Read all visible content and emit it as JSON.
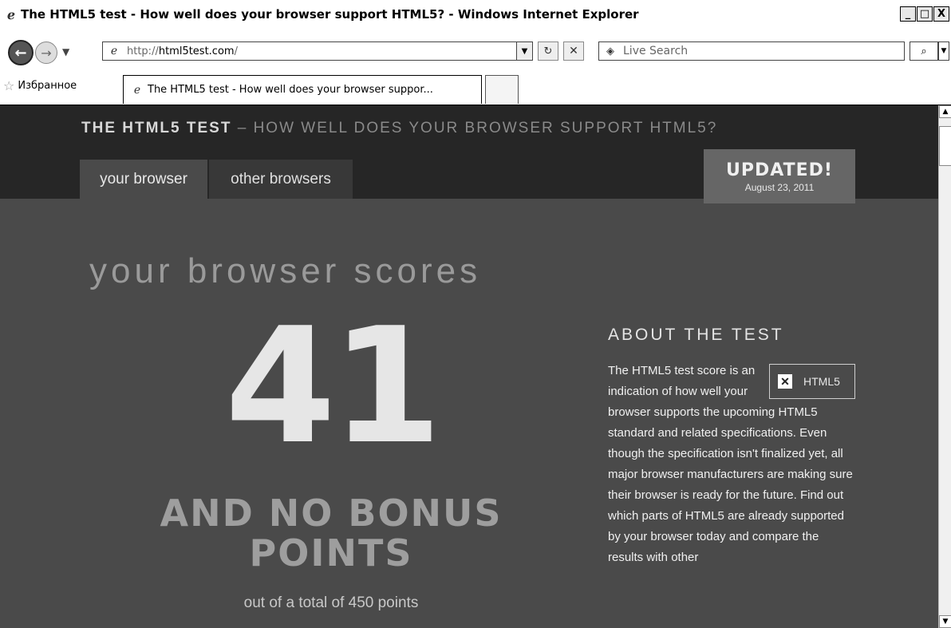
{
  "window": {
    "title": "The HTML5 test - How well does your browser support HTML5? - Windows Internet Explorer",
    "controls": [
      "_",
      "□",
      "X"
    ]
  },
  "toolbar": {
    "address_prefix": "http://",
    "address_domain": "html5test.com",
    "address_suffix": "/",
    "search_placeholder": "Live Search"
  },
  "favorites": {
    "label": "Избранное"
  },
  "tabs": [
    {
      "label": "The HTML5 test - How well does your browser suppor..."
    }
  ],
  "site": {
    "title_main": "THE HTML5 TEST",
    "title_sub": " – HOW WELL DOES YOUR BROWSER SUPPORT HTML5?",
    "nav": [
      "your browser",
      "other browsers"
    ],
    "updated_label": "UPDATED!",
    "updated_date": "August 23, 2011"
  },
  "score": {
    "heading": "your browser scores",
    "value": "41",
    "bonus_line1": "AND NO BONUS",
    "bonus_line2": "POINTS",
    "total": "out of a total of 450 points"
  },
  "about": {
    "heading": "ABOUT THE TEST",
    "badge": "HTML5",
    "text": "The HTML5 test score is an indication of how well your browser supports the upcoming HTML5 standard and related specifications. Even though the specification isn't finalized yet, all major browser manufacturers are making sure their browser is ready for the future. Find out which parts of HTML5 are already supported by your browser today and compare the results with other"
  }
}
